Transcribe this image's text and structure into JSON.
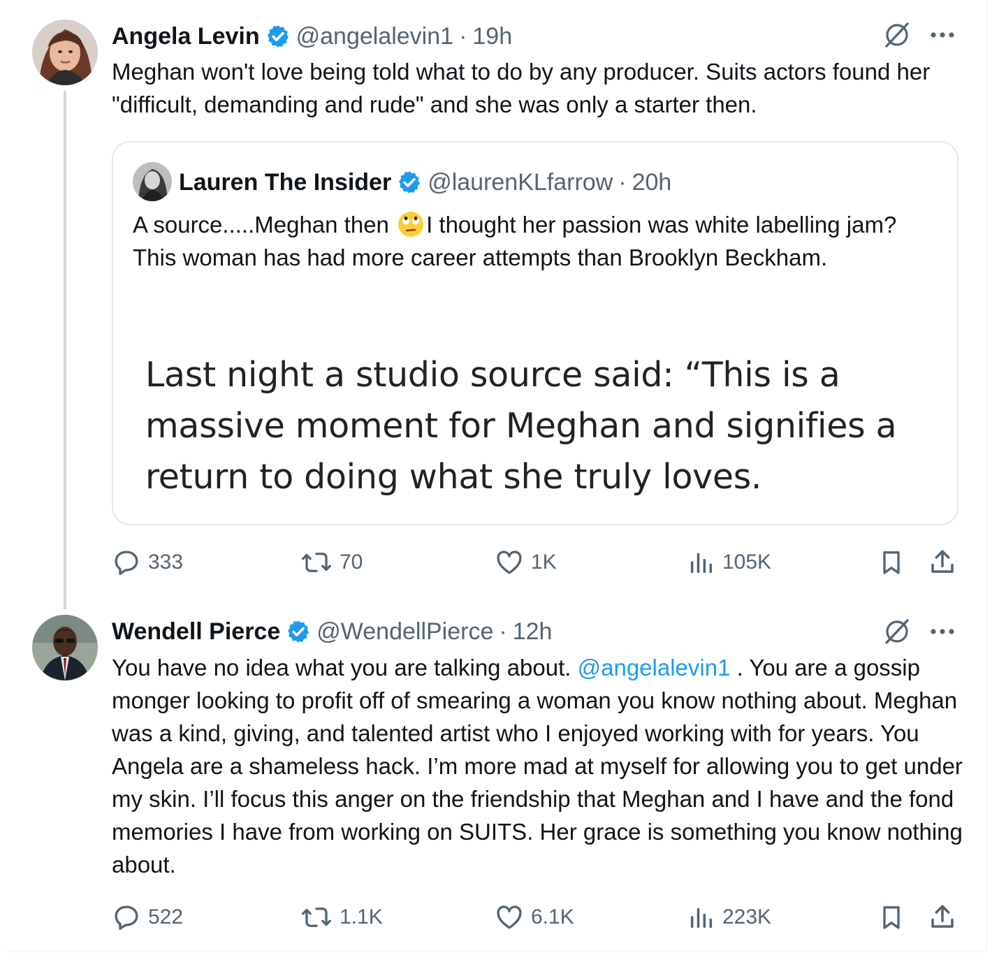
{
  "tweet1": {
    "name": "Angela Levin",
    "handle": "@angelalevin1",
    "dot": "·",
    "time": "19h",
    "text": "Meghan won't love being told what to do by any  producer.  Suits actors found her \"difficult, demanding and rude\"  and she was only a starter then.",
    "quote": {
      "name": "Lauren The Insider",
      "handle": "@laurenKLfarrow",
      "dot": "·",
      "time": "20h",
      "text_before": "A source.....Meghan then ",
      "emoji": "face-with-rolling-eyes-emoji",
      "text_after": "I thought her passion was white labelling jam? This woman has had more career attempts than Brooklyn Beckham.",
      "image_text": "Last night a studio source said: “This is a massive moment for Meghan and signifies a return to doing what she truly loves."
    },
    "replies": "333",
    "reposts": "70",
    "likes": "1K",
    "views": "105K"
  },
  "tweet2": {
    "name": "Wendell Pierce",
    "handle": "@WendellPierce",
    "dot": "·",
    "time": "12h",
    "text_before": "You have no idea what you are talking about. ",
    "mention": "@angelalevin1",
    "text_after": " . You are a gossip monger looking to profit off of smearing a woman you know nothing about. Meghan was a kind, giving, and talented artist who I enjoyed working with for years. You Angela are a shameless hack. I’m more mad at myself for allowing you to get under my skin. I’ll focus this anger on the friendship that Meghan and I have and the fond memories I have from working on SUITS. Her grace is something you know nothing about.",
    "replies": "522",
    "reposts": "1.1K",
    "likes": "6.1K",
    "views": "223K"
  },
  "colors": {
    "text": "#0f1419",
    "secondary": "#536471",
    "verified": "#1d9bf0",
    "mention": "#1d9bf0",
    "border": "#e3e8eb"
  },
  "icons": [
    "verified-badge-icon",
    "grok-icon",
    "more-icon",
    "reply-icon",
    "repost-icon",
    "like-icon",
    "views-icon",
    "bookmark-icon",
    "share-icon"
  ]
}
